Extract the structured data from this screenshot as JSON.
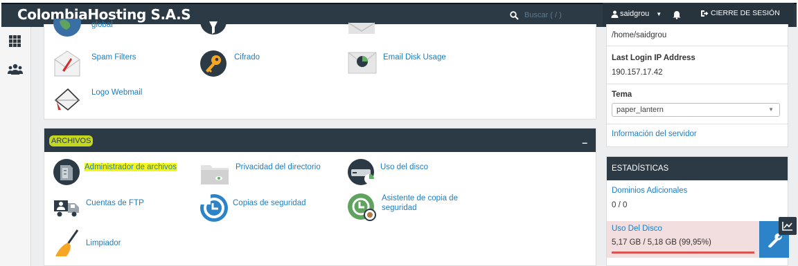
{
  "header": {
    "brand": "ColombiaHosting S.A.S",
    "search_placeholder": "Buscar ( / )",
    "user": "saidgrou",
    "logout": "CIERRE DE SESIÓN"
  },
  "email_section": {
    "items": [
      {
        "label": "global",
        "icon": "globe-icon"
      },
      {
        "label": "Spam Filters",
        "icon": "spam-filter-icon"
      },
      {
        "label": "Cifrado",
        "icon": "key-icon"
      },
      {
        "label": "Email Disk Usage",
        "icon": "email-disk-icon"
      },
      {
        "label": "Logo Webmail",
        "icon": "webmail-icon"
      }
    ]
  },
  "files_section": {
    "title": "ARCHIVOS",
    "collapse": "–",
    "items": [
      {
        "label": "Administrador de archivos",
        "icon": "file-manager-icon"
      },
      {
        "label": "Privacidad del directorio",
        "icon": "folder-privacy-icon"
      },
      {
        "label": "Uso del disco",
        "icon": "disk-usage-icon"
      },
      {
        "label": "Cuentas de FTP",
        "icon": "ftp-icon"
      },
      {
        "label": "Copias de seguridad",
        "icon": "backup-icon"
      },
      {
        "label": "Asistente de copia de seguridad",
        "icon": "backup-wizard-icon"
      },
      {
        "label": "Limpiador",
        "icon": "broom-icon"
      }
    ]
  },
  "account_info": {
    "home_dir": "/home/saidgrou",
    "last_login_label": "Last Login IP Address",
    "last_login_value": "190.157.17.42",
    "theme_label": "Tema",
    "theme_value": "paper_lantern",
    "server_info_link": "Información del servidor"
  },
  "stats": {
    "title": "ESTADÍSTICAS",
    "addon_domains_label": "Dominios Adicionales",
    "addon_domains_value": "0 / 0",
    "disk_label": "Uso Del Disco",
    "disk_value": "5,17 GB / 5,18 GB  (99,95%)",
    "disk_fraction": 0.9995
  },
  "colors": {
    "header": "#2b3a45",
    "link": "#1b7ec1",
    "highlight": "#f6f51a",
    "danger": "#d9534f",
    "wrench_bg": "#2c83c8"
  }
}
